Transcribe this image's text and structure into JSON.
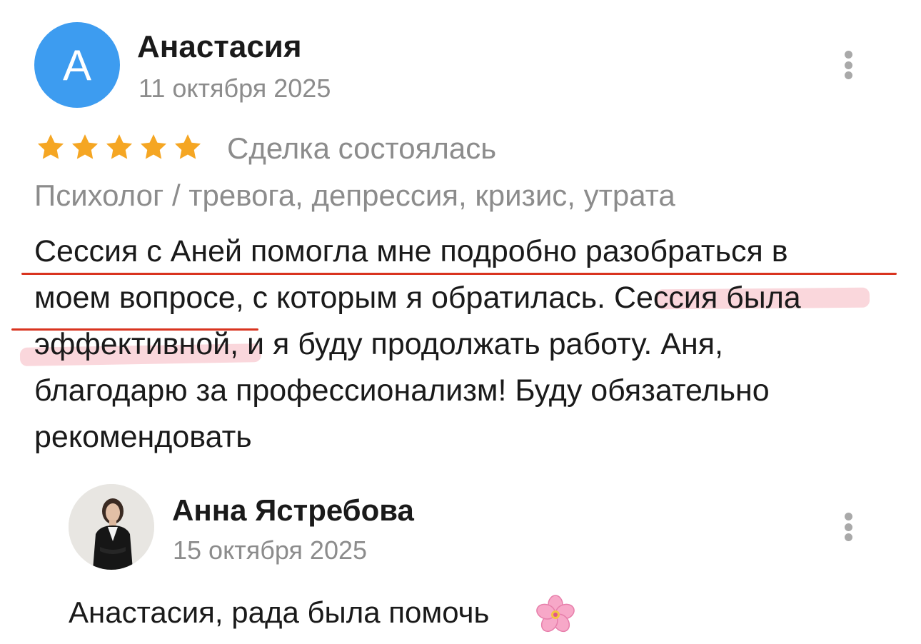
{
  "review": {
    "avatar_letter": "А",
    "author": "Анастасия",
    "date": "11 октября 2025",
    "rating": 5,
    "rating_max": 5,
    "deal_status": "Сделка состоялась",
    "category": "Психолог / тревога, депрессия, кризис, утрата",
    "text_part1": "Сессия с Аней помогла мне подробно разобраться в\nмоем вопросе, с которым я обратилась. ",
    "text_highlight": "Сессия была\nэффективной,",
    "text_part2": " и я буду продолжать работу. Аня,\nблагодарю за профессионализм! Буду обязательно\nрекомендовать",
    "menu_icon": "more-vertical-icon"
  },
  "reply": {
    "author": "Анна Ястребова",
    "date": "15 октября 2025",
    "text": "Анастасия, рада была помочь",
    "emoji_icon": "cherry-blossom-icon",
    "menu_icon": "more-vertical-icon"
  },
  "colors": {
    "avatar_bg": "#3d9cf0",
    "star": "#f5a623",
    "muted_text": "#8c8c8c",
    "annotation_line": "#d9341f",
    "annotation_highlight": "#ec6e82"
  }
}
